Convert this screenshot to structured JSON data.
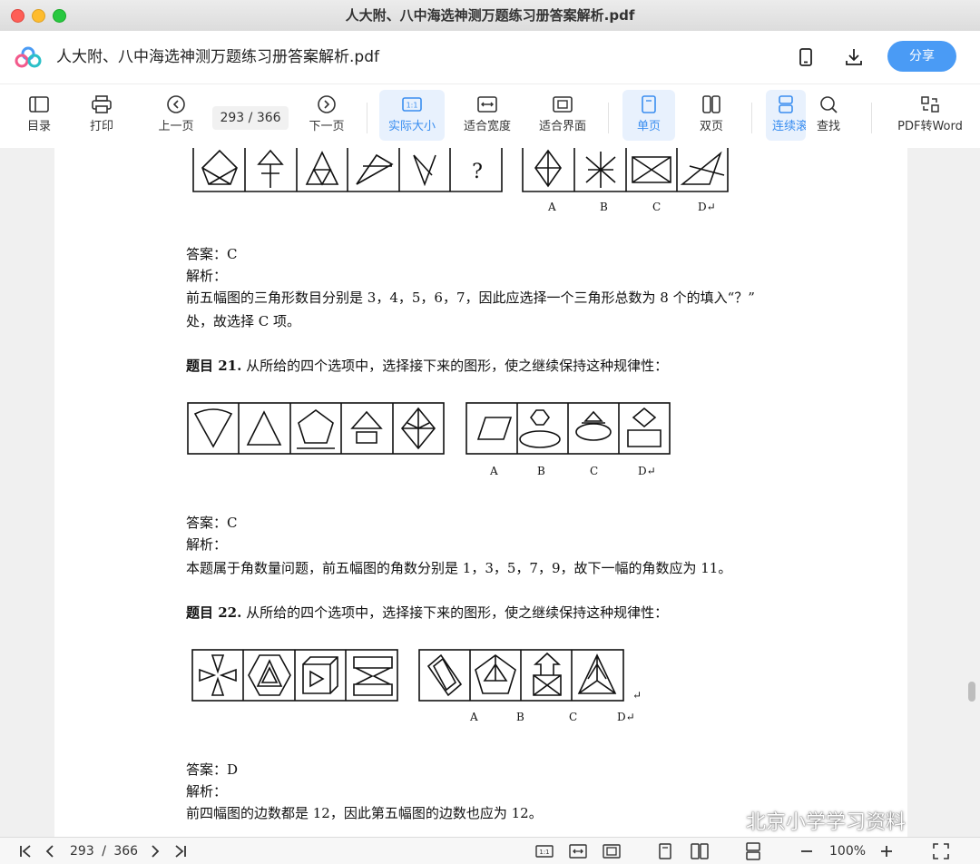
{
  "window": {
    "title": "人大附、八中海选神测万题练习册答案解析.pdf"
  },
  "appbar": {
    "doc_title": "人大附、八中海选神测万题练习册答案解析.pdf",
    "share_label": "分享"
  },
  "toolbar": {
    "toc": "目录",
    "print": "打印",
    "prev": "上一页",
    "page_current": "293",
    "page_total": "366",
    "page_sep": "/",
    "next": "下一页",
    "actual": "实际大小",
    "fitwidth": "适合宽度",
    "fitpage": "适合界面",
    "single": "单页",
    "double": "双页",
    "continuous": "连续滚",
    "find": "查找",
    "toword": "PDF转Word"
  },
  "doc": {
    "q20": {
      "answer": "答案：C",
      "analysis": "解析：",
      "line1": "前五幅图的三角形数目分别是 3，4，5，6，7，因此应选择一个三角形总数为 8 个的填入“？”",
      "line2": "处，故选择 C 项。",
      "qmark": "?",
      "opts": [
        "A",
        "B",
        "C",
        "D↵"
      ]
    },
    "q21": {
      "title": "题目 21.",
      "stem": "从所给的四个选项中，选择接下来的图形，使之继续保持这种规律性：",
      "answer": "答案：C",
      "analysis": "解析：",
      "line1": "本题属于角数量问题，前五幅图的角数分别是 1，3，5，7，9，故下一幅的角数应为 11。",
      "opts": [
        "A",
        "B",
        "C",
        "D↵"
      ]
    },
    "q22": {
      "title": "题目 22.",
      "stem": "从所给的四个选项中，选择接下来的图形，使之继续保持这种规律性：",
      "answer": "答案：D",
      "analysis": "解析：",
      "line1": "前四幅图的边数都是 12，因此第五幅图的边数也应为 12。",
      "opts": [
        "A",
        "B",
        "C",
        "D↵"
      ],
      "return_mark": "↵"
    }
  },
  "bottombar": {
    "page_current": "293",
    "page_sep": "/",
    "page_total": "366",
    "zoom": "100%",
    "actual_icon": "1:1"
  },
  "watermark": "北京小学学习资料"
}
